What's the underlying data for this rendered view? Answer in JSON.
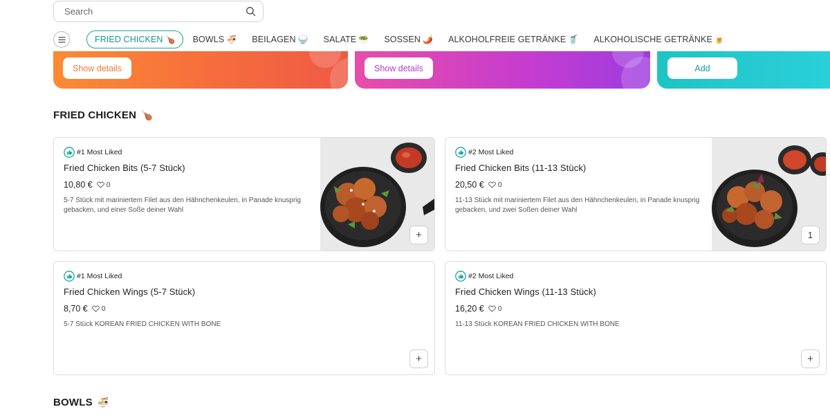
{
  "search": {
    "placeholder": "Search",
    "icon": "search-icon"
  },
  "nav": {
    "menu_icon": "hamburger-menu-icon",
    "categories": [
      {
        "label": "FRIED CHICKEN",
        "emoji": "🍗",
        "active": true
      },
      {
        "label": "BOWLS",
        "emoji": "🍜",
        "active": false
      },
      {
        "label": "BEILAGEN",
        "emoji": "🍚",
        "active": false
      },
      {
        "label": "SALATE",
        "emoji": "🥗",
        "active": false
      },
      {
        "label": "SOSSEN",
        "emoji": "🌶️",
        "active": false
      },
      {
        "label": "ALKOHOLFREIE GETRÄNKE",
        "emoji": "🥤",
        "active": false
      },
      {
        "label": "ALKOHOLISCHE GETRÄNKE",
        "emoji": "🍺",
        "active": false
      }
    ]
  },
  "banners": [
    {
      "button": "Show details",
      "color_start": "#fb8b33",
      "color_end": "#ef5a45"
    },
    {
      "button": "Show details",
      "color_start": "#e84da9",
      "color_end": "#9d3be0"
    },
    {
      "button": "Add",
      "color_start": "#1ec4c3",
      "color_end": "#2ad0d9"
    }
  ],
  "sections": [
    {
      "title": "FRIED CHICKEN",
      "emoji": "🍗",
      "products": [
        {
          "badge": "#1 Most Liked",
          "name": "Fried Chicken Bits (5-7 Stück)",
          "price": "10,80 €",
          "likes": "0",
          "description": "5-7 Stück mit mariniertem Filet aus den Hähnchenkeulen, in Panade knusprig gebacken, und einer Soße deiner Wahl",
          "has_image": true,
          "action": "+"
        },
        {
          "badge": "#2 Most Liked",
          "name": "Fried Chicken Bits (11-13 Stück)",
          "price": "20,50 €",
          "likes": "0",
          "description": "11-13 Stück mit mariniertem Filet aus den Hähnchenkeulen, in Panade knusprig gebacken, und zwei Soßen deiner Wahl",
          "has_image": true,
          "action": "1"
        },
        {
          "badge": "#1 Most Liked",
          "name": "Fried Chicken Wings (5-7 Stück)",
          "price": "8,70 €",
          "likes": "0",
          "description": "5-7 Stück KOREAN FRIED CHICKEN WITH BONE",
          "has_image": false,
          "action": "+"
        },
        {
          "badge": "#2 Most Liked",
          "name": "Fried Chicken Wings (11-13 Stück)",
          "price": "16,20 €",
          "likes": "0",
          "description": "11-13 Stück KOREAN FRIED CHICKEN WITH BONE",
          "has_image": false,
          "action": "+"
        }
      ]
    },
    {
      "title": "BOWLS",
      "emoji": "🍜"
    }
  ],
  "colors": {
    "accent": "#13988f",
    "border": "#dedede"
  }
}
